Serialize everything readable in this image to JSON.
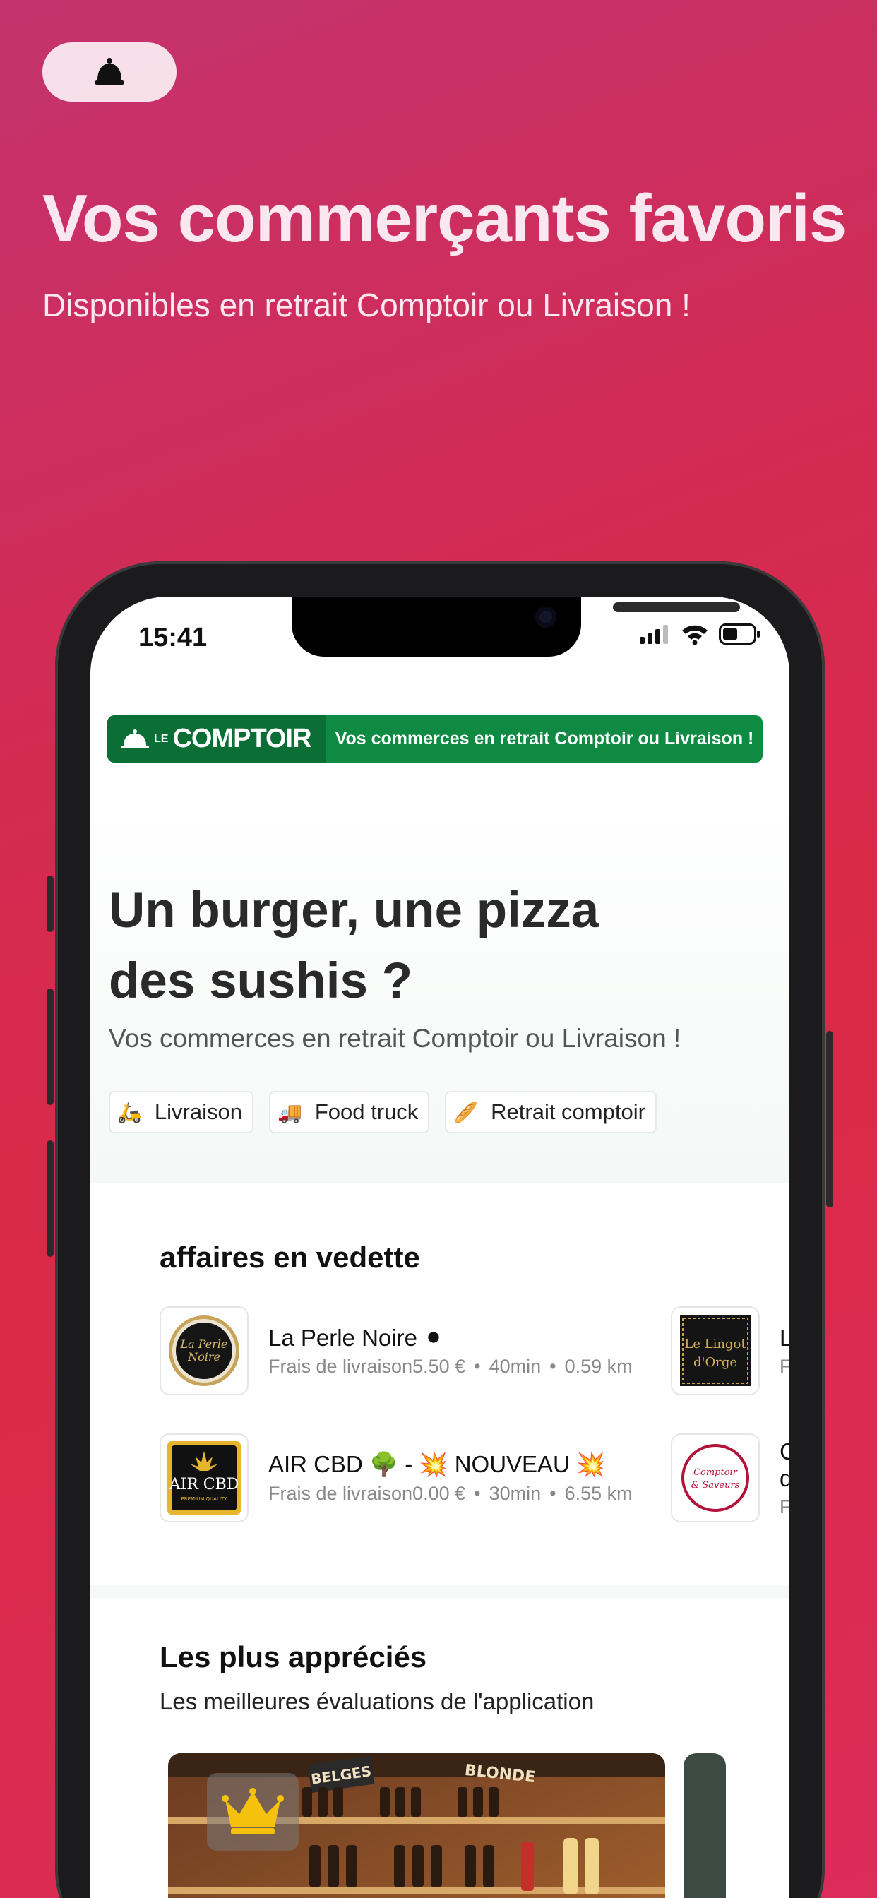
{
  "banner": {
    "title": "Vos commerçants favoris",
    "subtitle": "Disponibles en retrait Comptoir ou Livraison !"
  },
  "status_bar": {
    "time": "15:41"
  },
  "app": {
    "brand": {
      "le": "LE",
      "name": "COMPTOIR",
      "tagline": "Vos commerces en retrait Comptoir ou Livraison !"
    },
    "hero": {
      "title": "Un burger, une pizza des sushis ?",
      "subtitle": "Vos commerces en retrait Comptoir ou Livraison !"
    },
    "chips": [
      {
        "icon": "🛵",
        "label": "Livraison"
      },
      {
        "icon": "🚚",
        "label": "Food truck"
      },
      {
        "icon": "🥖",
        "label": "Retrait comptoir"
      }
    ],
    "featured": {
      "title": "affaires en vedette",
      "shops": [
        {
          "name": "La Perle Noire ⚫",
          "fee_label": "Frais de livraison",
          "fee": "5.50 €",
          "time": "40min",
          "distance": "0.59 km",
          "logo_text": "La Perle Noire"
        },
        {
          "name": "AIR CBD 🌳 -  💥 NOUVEAU 💥",
          "fee_label": "Frais de livraison",
          "fee": "0.00 €",
          "time": "30min",
          "distance": "6.55 km",
          "logo_text": "AIR CBD"
        }
      ],
      "side_shops": [
        {
          "logo_text": "Le Lingot d'Orge",
          "peek_letter": "L",
          "peek_meta": "F"
        },
        {
          "logo_text": "Comptoir & Saveurs",
          "peek_letter": "C",
          "peek_line2": "d",
          "peek_meta": "F"
        }
      ]
    },
    "top_rated": {
      "title": "Les plus appréciés",
      "subtitle": "Les meilleures évaluations de l'application",
      "card_sign": "BELGES",
      "card_sign2": "BLONDE"
    }
  },
  "colors": {
    "brand_green": "#0e8a43",
    "banner_gradient_start": "#c4336e",
    "banner_gradient_end": "#db2a47"
  }
}
